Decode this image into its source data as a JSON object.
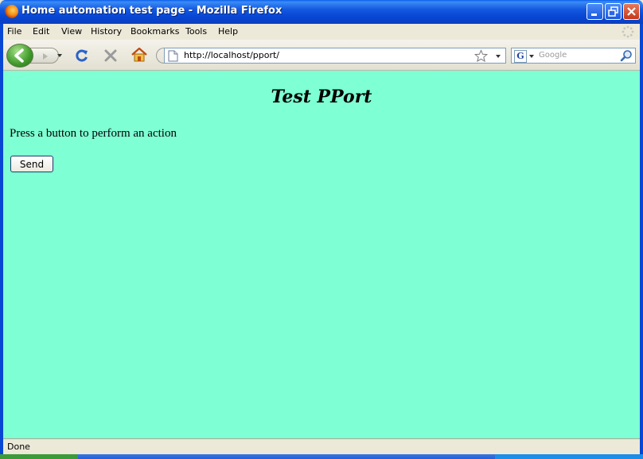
{
  "window": {
    "title": "Home automation test page - Mozilla Firefox"
  },
  "menu": {
    "items": [
      "File",
      "Edit",
      "View",
      "History",
      "Bookmarks",
      "Tools",
      "Help"
    ]
  },
  "toolbar": {
    "url": "http://localhost/pport/",
    "search_placeholder": "Google",
    "search_engine_letter": "G"
  },
  "page": {
    "heading": "Test PPort",
    "instruction": "Press a button to perform an action",
    "send_label": "Send"
  },
  "status": {
    "text": "Done"
  },
  "colors": {
    "page_background": "#7fffd4",
    "titlebar": "#0846d4"
  },
  "icons": [
    "firefox-logo-icon",
    "minimize-icon",
    "maximize-icon",
    "close-icon",
    "throbber-icon",
    "back-arrow-icon",
    "forward-arrow-icon",
    "history-dropdown-icon",
    "reload-icon",
    "stop-icon",
    "home-icon",
    "page-icon",
    "bookmark-star-icon",
    "url-dropdown-icon",
    "search-engine-dropdown-icon",
    "magnifier-icon"
  ]
}
